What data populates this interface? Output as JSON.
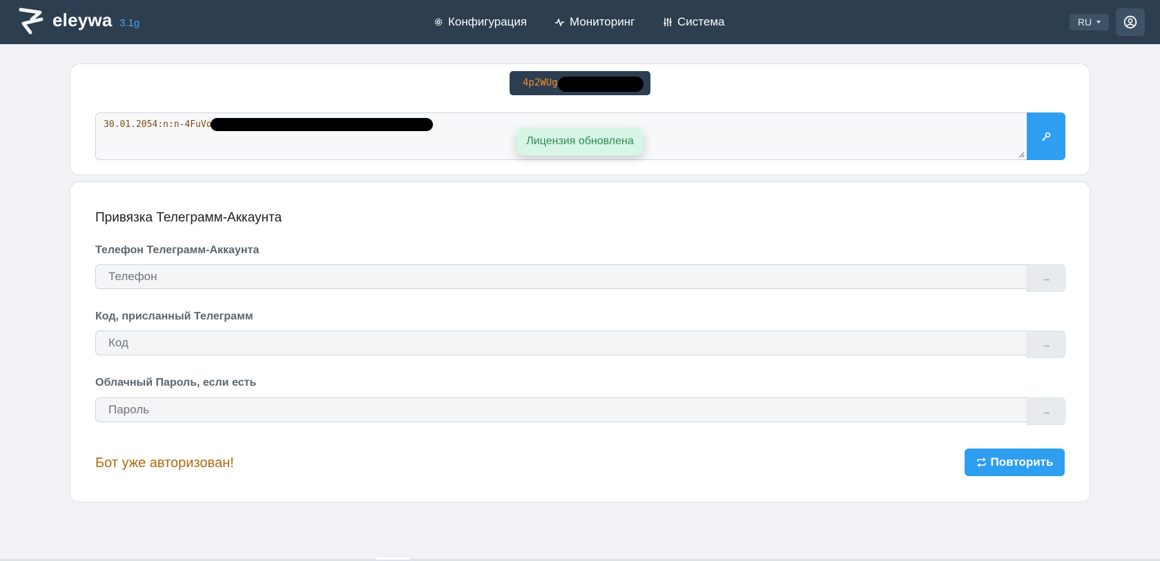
{
  "app": {
    "brand": "eleywa",
    "version": "3.1g",
    "colors": {
      "topbar": "#2c3e50",
      "accent": "#2e9ef0",
      "warning_text": "#b06a10",
      "success_bg": "#d7f6e6"
    }
  },
  "nav": {
    "items": [
      {
        "label": "Конфигурация",
        "icon": "gear-icon"
      },
      {
        "label": "Мониторинг",
        "icon": "pulse-icon"
      },
      {
        "label": "Система",
        "icon": "sliders-icon"
      }
    ],
    "language": "RU",
    "account_icon": "user-circle-icon"
  },
  "license": {
    "key_visible": "4p2WUg",
    "text_visible": "30.01.2054:n:n-4FuVo",
    "apply_icon": "key-icon",
    "toast": "Лицензия обновлена"
  },
  "telegram": {
    "title": "Привязка Телеграмм-Аккаунта",
    "fields": [
      {
        "label": "Телефон Телеграмм-Аккаунта",
        "placeholder": "Телефон",
        "button": "→"
      },
      {
        "label": "Код, присланный Телеграмм",
        "placeholder": "Код",
        "button": "→"
      },
      {
        "label": "Облачный Пароль, если есть",
        "placeholder": "Пароль",
        "button": "→"
      }
    ],
    "status": "Бот уже авторизован!",
    "retry_label": "Повторить"
  }
}
